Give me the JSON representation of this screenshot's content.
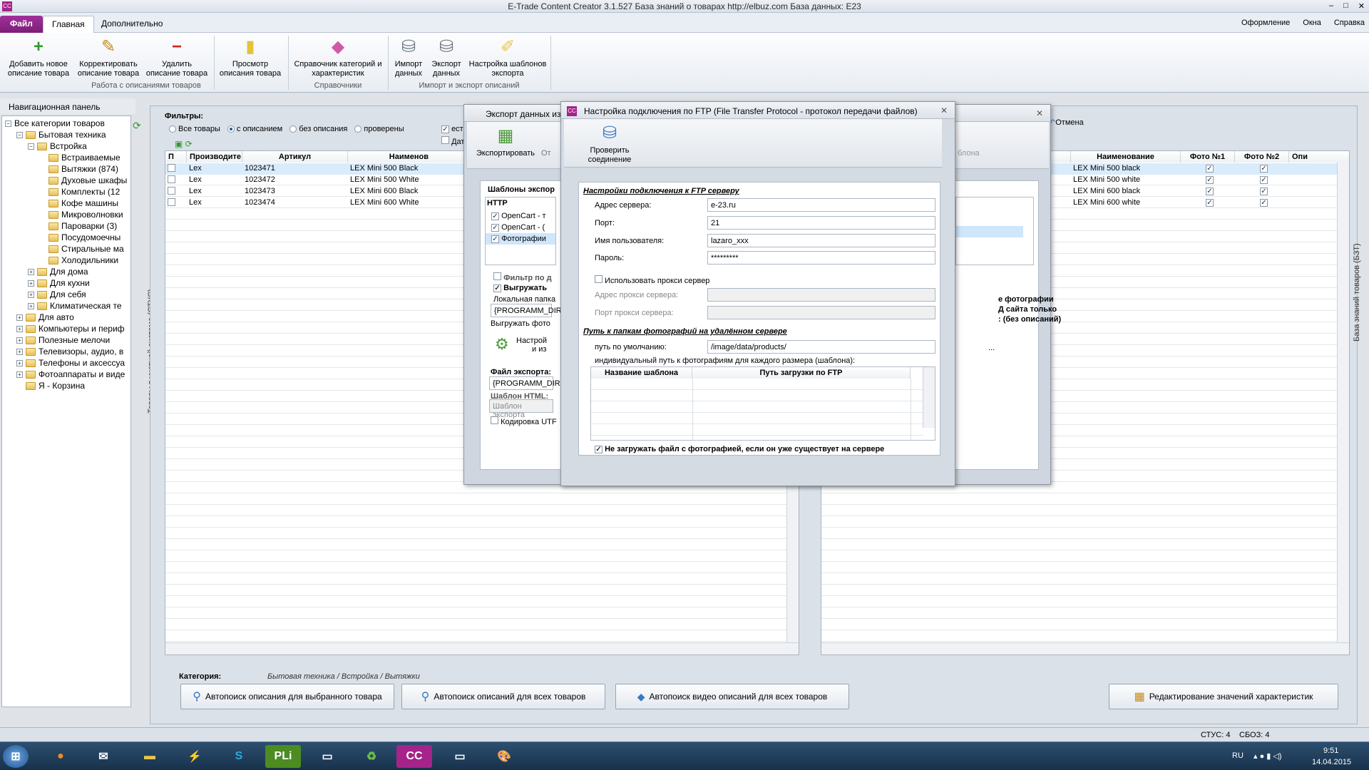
{
  "window": {
    "title": "E-Trade Content Creator 3.1.527     База знаний о товарах     http://elbuz.com     База данных: E23",
    "app_icon": "CC",
    "controls": [
      "–",
      "□",
      "✕"
    ]
  },
  "ribbon_tabs": {
    "file": "Файл",
    "home": "Главная",
    "extra": "Дополнительно",
    "design": "Оформление",
    "window": "Окна",
    "help": "Справка"
  },
  "ribbon": {
    "add": "Добавить новое описание товара",
    "edit": "Корректировать описание товара",
    "delete": "Удалить описание товара",
    "view": "Просмотр описания товара",
    "group1": "Работа с описаниями товаров",
    "catalog": "Справочник категорий и характеристик",
    "group2": "Справочники",
    "import": "Импорт данных",
    "export": "Экспорт данных",
    "templates": "Настройка шаблонов экспорта",
    "group3": "Импорт и экспорт описаний"
  },
  "nav": {
    "title": "Навигационная панель",
    "tree": [
      {
        "label": "Все категории товаров",
        "indent": 0,
        "exp": "−"
      },
      {
        "label": "Бытовая техника",
        "indent": 1,
        "exp": "−"
      },
      {
        "label": "Встройка",
        "indent": 2,
        "exp": "−"
      },
      {
        "label": "Встраиваемые",
        "indent": 3,
        "exp": ""
      },
      {
        "label": "Вытяжки (874)",
        "indent": 3,
        "exp": ""
      },
      {
        "label": "Духовые шкафы",
        "indent": 3,
        "exp": ""
      },
      {
        "label": "Комплекты (12",
        "indent": 3,
        "exp": ""
      },
      {
        "label": "Кофе машины",
        "indent": 3,
        "exp": ""
      },
      {
        "label": "Микроволновки",
        "indent": 3,
        "exp": ""
      },
      {
        "label": "Пароварки (3)",
        "indent": 3,
        "exp": ""
      },
      {
        "label": "Посудомоечны",
        "indent": 3,
        "exp": ""
      },
      {
        "label": "Стиральные ма",
        "indent": 3,
        "exp": ""
      },
      {
        "label": "Холодильники",
        "indent": 3,
        "exp": ""
      },
      {
        "label": "Для дома",
        "indent": 2,
        "exp": "+"
      },
      {
        "label": "Для кухни",
        "indent": 2,
        "exp": "+"
      },
      {
        "label": "Для себя",
        "indent": 2,
        "exp": "+"
      },
      {
        "label": "Климатическая те",
        "indent": 2,
        "exp": "+"
      },
      {
        "label": "Для авто",
        "indent": 1,
        "exp": "+"
      },
      {
        "label": "Компьютеры и периф",
        "indent": 1,
        "exp": "+"
      },
      {
        "label": "Полезные мелочи",
        "indent": 1,
        "exp": "+"
      },
      {
        "label": "Телевизоры, аудио, в",
        "indent": 1,
        "exp": "+"
      },
      {
        "label": "Телефоны и аксессуа",
        "indent": 1,
        "exp": "+"
      },
      {
        "label": "Фотоаппараты и виде",
        "indent": 1,
        "exp": "+"
      },
      {
        "label": "Я - Корзина",
        "indent": 1,
        "exp": ""
      }
    ],
    "side_label": "Товары в учетной системе (СТУС)"
  },
  "filters": {
    "title": "Фильтры:",
    "options": [
      "Все товары",
      "с описанием",
      "без описания",
      "проверены"
    ],
    "selected": "с описанием",
    "est": "ест",
    "dat": "Дат"
  },
  "left_grid": {
    "headers": [
      "П",
      "Производите",
      "Артикул",
      "Наименов"
    ],
    "rows": [
      {
        "maker": "Lex",
        "sku": "1023471",
        "name": "LEX Mini 500 Black"
      },
      {
        "maker": "Lex",
        "sku": "1023472",
        "name": "LEX Mini 500 White"
      },
      {
        "maker": "Lex",
        "sku": "1023473",
        "name": "LEX Mini 600 Black"
      },
      {
        "maker": "Lex",
        "sku": "1023474",
        "name": "LEX Mini 600 White"
      }
    ]
  },
  "right_grid": {
    "cancel": "Отмена",
    "headers": [
      "Наименование",
      "Фото №1",
      "Фото №2",
      "Опи"
    ],
    "rows": [
      "LEX Mini 500 black",
      "LEX Mini 500 white",
      "LEX Mini 600 black",
      "LEX Mini 600 white"
    ],
    "side_label": "База знаний товаров (БЗТ)",
    "snippet1": "е фотографии",
    "snippet2": "Д сайта только",
    "snippet3": ": (без описаний)",
    "ellipsis": "..."
  },
  "bottom": {
    "category_label": "Категория:",
    "category_path": "Бытовая техника / Встройка / Вытяжки",
    "btn1": "Автопоиск описания для выбранного товара",
    "btn2": "Автопоиск описаний для всех товаров",
    "btn3": "Автопоиск видео описаний для всех товаров",
    "btn4": "Редактирование значений характеристик"
  },
  "status": {
    "stus": "СТУС: 4",
    "sbz": "СБОЗ: 4"
  },
  "export_dialog": {
    "title": "Экспорт данных из",
    "export_btn": "Экспортировать",
    "from": "От",
    "templates": "Шаблоны экспор",
    "http": "HTTP",
    "rows": [
      "OpenCart - т",
      "OpenCart - (",
      "Фотографии"
    ],
    "filter": "Фильтр по д",
    "upload": "Выгружать",
    "local_folder": "Локальная папка",
    "local_path": "{PROGRAMM_DIR",
    "upload_photo": "Выгружать фото",
    "setup1": "Настрой",
    "setup2": "и из",
    "export_file": "Файл экспорта:",
    "export_path": "{PROGRAMM_DIR}",
    "html_tpl": "Шаблон HTML:",
    "html_placeholder": "Шаблон экспорта",
    "encoding": "Кодировка UTF",
    "bg_tab": "блона"
  },
  "ftp_dialog": {
    "title": "Настройка подключения по FTP (File Transfer Protocol - протокол передачи файлов)",
    "check_btn": "Проверить соединение",
    "section1": "Настройки подключения к FTP серверу",
    "server_label": "Адрес сервера:",
    "server": "e-23.ru",
    "port_label": "Порт:",
    "port": "21",
    "user_label": "Имя пользователя:",
    "user": "lazaro_xxx",
    "pass_label": "Пароль:",
    "pass": "*********",
    "proxy": "Использовать прокси сервер",
    "proxy_addr": "Адрес прокси сервера:",
    "proxy_port": "Порт прокси сервера:",
    "section2": "Путь к папкам фотографий на удалённом сервере",
    "default_label": "путь по умолчанию:",
    "default_path": "/image/data/products/",
    "individual": "индивидуальный путь к фотографиям для каждого размера (шаблона):",
    "col1": "Название шаблона",
    "col2": "Путь загрузки по FTP",
    "skip": "Не загружать файл с фотографией, если он уже существует на сервере"
  },
  "taskbar": {
    "lang": "RU",
    "time": "9:51",
    "date": "14.04.2015"
  },
  "colors": {
    "accent": "#a5238a",
    "file_tab": "#8b2386",
    "taskbar": "#1f3c5a"
  }
}
